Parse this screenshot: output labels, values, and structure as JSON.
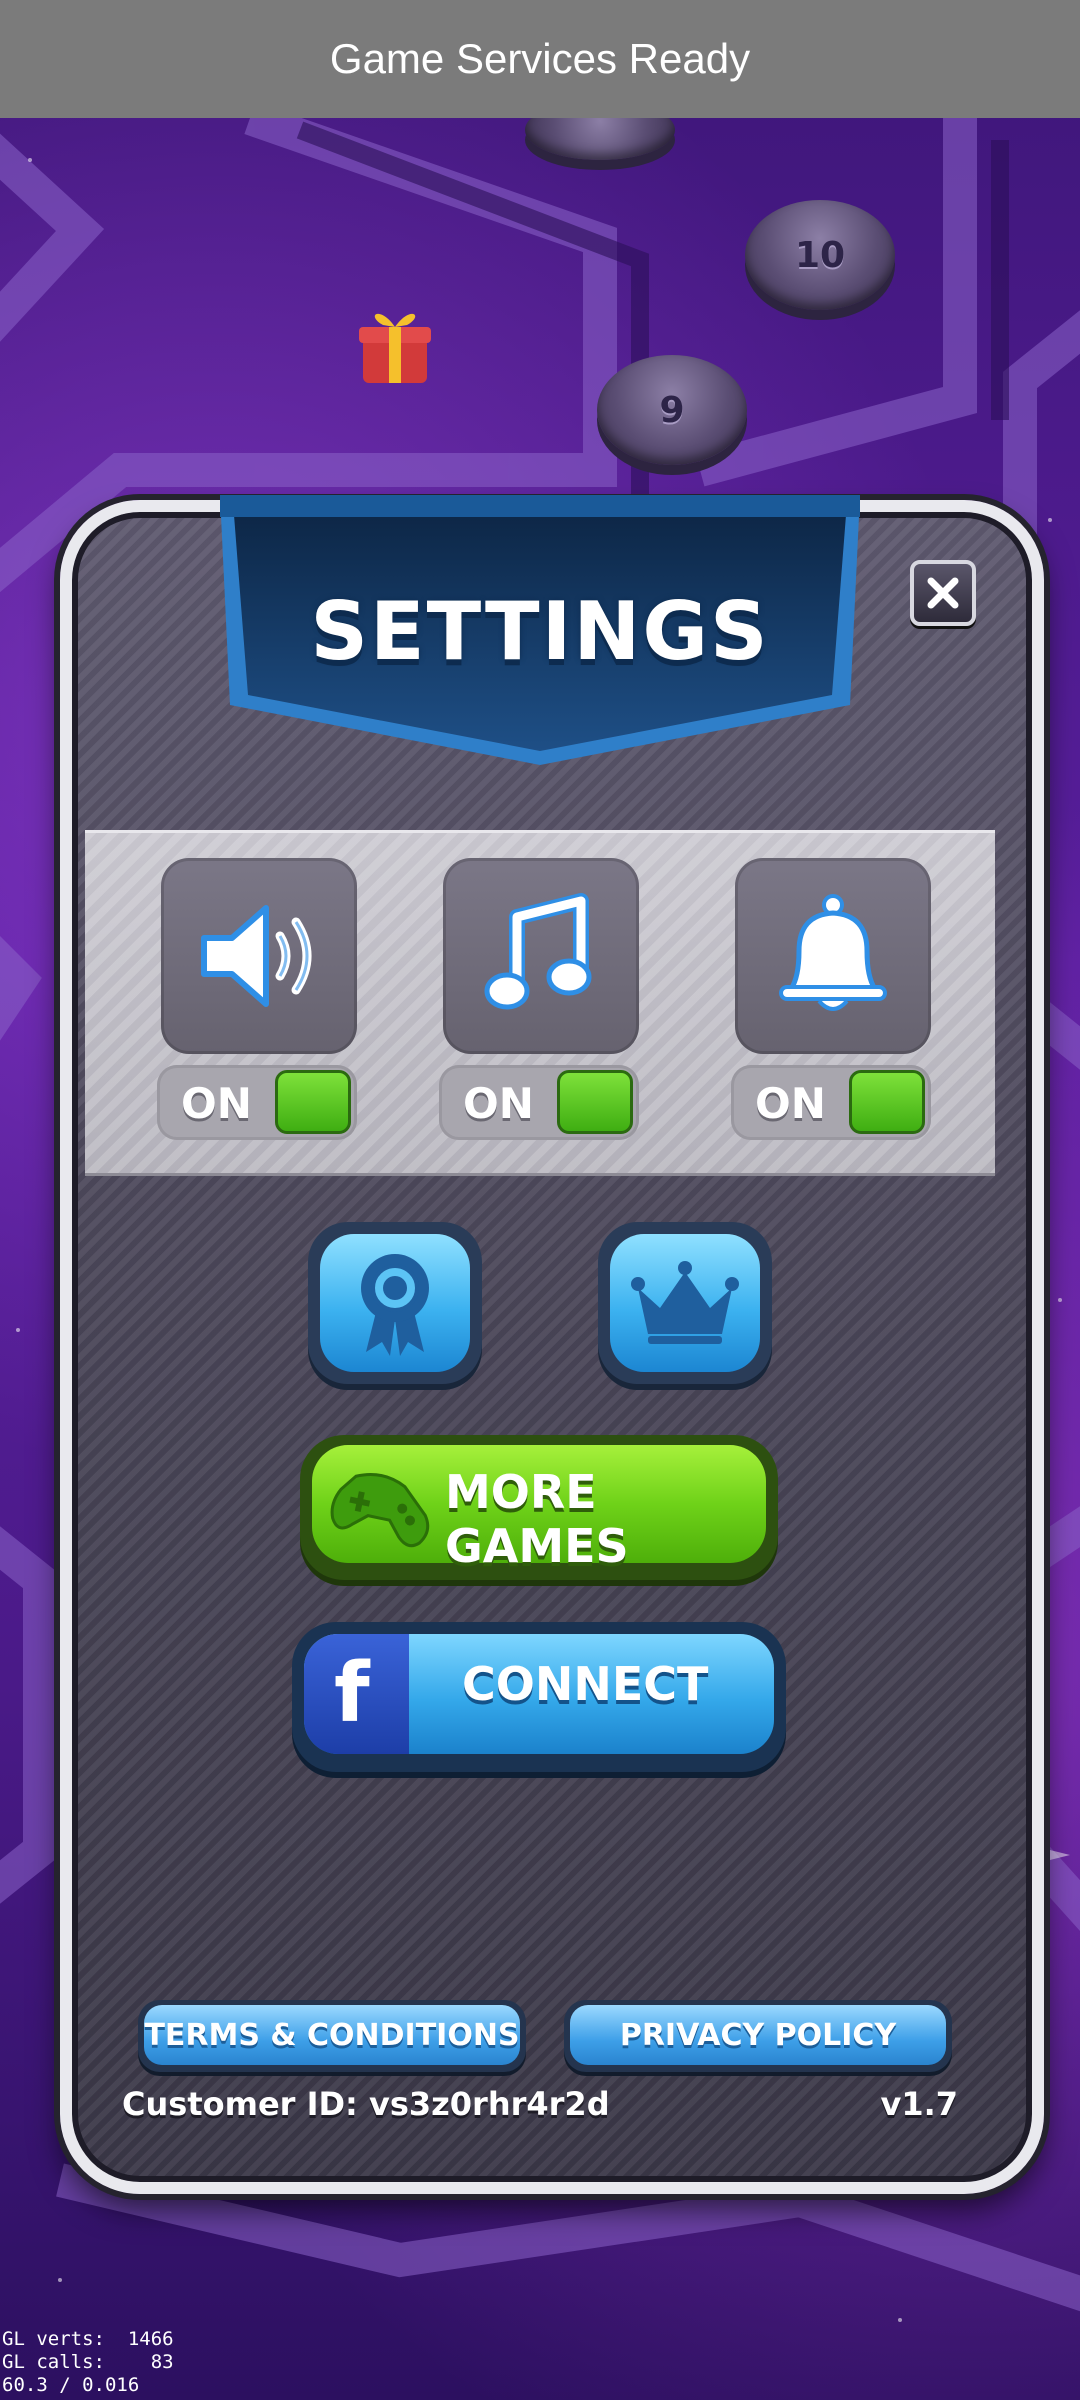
{
  "toast": {
    "text": "Game Services Ready"
  },
  "level_nodes": [
    "10",
    "9"
  ],
  "dialog": {
    "title": "SETTINGS",
    "toggles": [
      {
        "name": "sound",
        "icon": "speaker-icon",
        "state_label": "ON",
        "on": true
      },
      {
        "name": "music",
        "icon": "music-note-icon",
        "state_label": "ON",
        "on": true
      },
      {
        "name": "notifications",
        "icon": "bell-icon",
        "state_label": "ON",
        "on": true
      }
    ],
    "achievements_icon": "award-ribbon-icon",
    "leaderboard_icon": "crown-icon",
    "more_games_label": "MORE GAMES",
    "connect_label": "CONNECT",
    "facebook_letter": "f",
    "terms_label": "TERMS & CONDITIONS",
    "privacy_label": "PRIVACY POLICY",
    "customer_id": "Customer ID: vs3z0rhr4r2d",
    "version": "v1.7"
  },
  "debug": {
    "gl_verts": "GL verts:  1466",
    "gl_calls": "GL calls:    83",
    "fps": "60.3 / 0.016"
  },
  "colors": {
    "toggle_on": "#5cc21a",
    "primary_blue": "#3cb2f0",
    "more_games_green": "#6fd219",
    "facebook_blue": "#1d3ea8"
  }
}
